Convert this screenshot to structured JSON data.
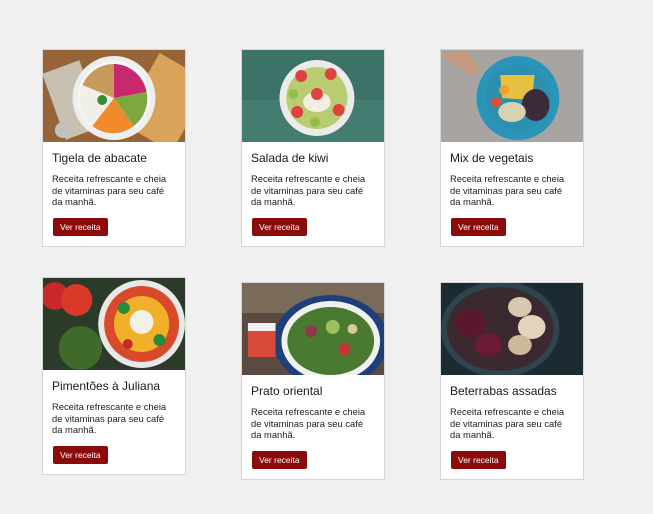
{
  "cards": [
    {
      "title": "Tigela de abacate",
      "description": "Receita refrescante e cheia de vitaminas para seu café da manhã.",
      "button_label": "Ver receita",
      "image": "acai-bowl-photo"
    },
    {
      "title": "Salada de kiwi",
      "description": "Receita refrescante e cheia de vitaminas para seu café da manhã.",
      "button_label": "Ver receita",
      "image": "kiwi-bowl-photo"
    },
    {
      "title": "Mix de vegetais",
      "description": "Receita refrescante e cheia de vitaminas para seu café da manhã.",
      "button_label": "Ver receita",
      "image": "vegetable-mix-photo"
    },
    {
      "title": "Pimentões à Juliana",
      "description": "Receita refrescante e cheia de vitaminas para seu café da manhã.",
      "button_label": "Ver receita",
      "image": "peppers-salad-photo"
    },
    {
      "title": "Prato oriental",
      "description": "Receita refrescante e cheia de vitaminas para seu café da manhã.",
      "button_label": "Ver receita",
      "image": "oriental-plate-photo"
    },
    {
      "title": "Beterrabas assadas",
      "description": "Receita refrescante e cheia de vitaminas para seu café da manhã.",
      "button_label": "Ver receita",
      "image": "roasted-beets-photo"
    }
  ],
  "colors": {
    "button": "#8b0a0a",
    "background": "#f0f0f0",
    "card": "#ffffff"
  }
}
